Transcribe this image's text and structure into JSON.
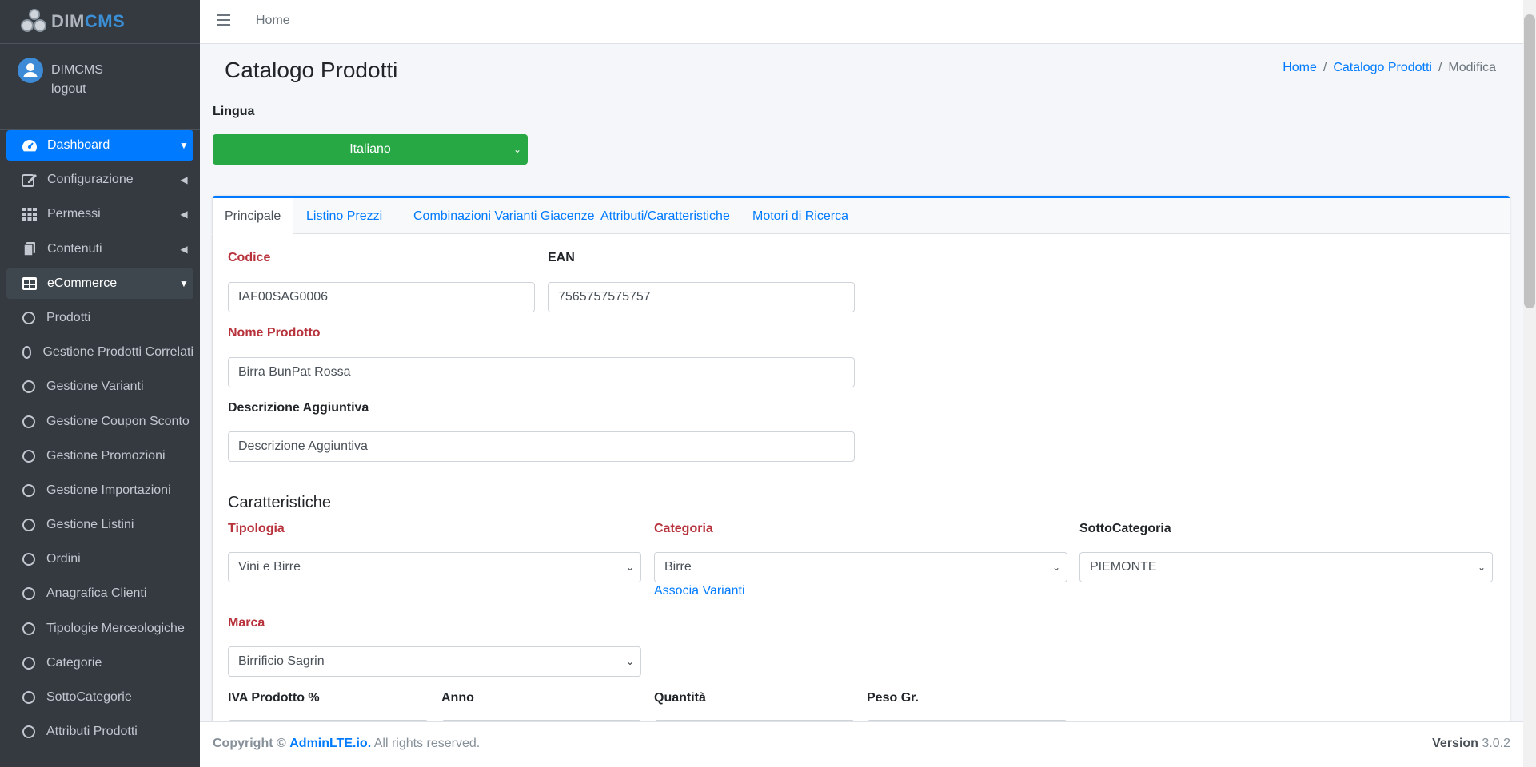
{
  "brand": {
    "part1": "DIM",
    "part2": "CMS"
  },
  "user": {
    "name": "DIMCMS",
    "logout": "logout"
  },
  "sidebar": {
    "items": [
      {
        "label": "Dashboard",
        "icon": "gauge-icon",
        "arrow": "down"
      },
      {
        "label": "Configurazione",
        "icon": "edit-icon",
        "arrow": "left"
      },
      {
        "label": "Permessi",
        "icon": "grid-icon",
        "arrow": "left"
      },
      {
        "label": "Contenuti",
        "icon": "copy-icon",
        "arrow": "left"
      },
      {
        "label": "eCommerce",
        "icon": "table-icon",
        "arrow": "down"
      }
    ],
    "subitems": [
      "Prodotti",
      "Gestione Prodotti Correlati",
      "Gestione Varianti",
      "Gestione Coupon Sconto",
      "Gestione Promozioni",
      "Gestione Importazioni",
      "Gestione Listini",
      "Ordini",
      "Anagrafica Clienti",
      "Tipologie Merceologiche",
      "Categorie",
      "SottoCategorie",
      "Attributi Prodotti"
    ]
  },
  "topbar": {
    "home": "Home"
  },
  "header": {
    "title": "Catalogo Prodotti",
    "breadcrumb": [
      "Home",
      "Catalogo Prodotti",
      "Modifica"
    ],
    "separator": "/"
  },
  "lingua": {
    "label": "Lingua",
    "value": "Italiano"
  },
  "tabs": [
    "Principale",
    "Listino Prezzi",
    "Combinazioni Varianti Giacenze",
    "Attributi/Caratteristiche",
    "Motori di Ricerca"
  ],
  "form": {
    "codice": {
      "label": "Codice",
      "value": "IAF00SAG0006"
    },
    "ean": {
      "label": "EAN",
      "value": "7565757575757"
    },
    "nome": {
      "label": "Nome Prodotto",
      "value": "Birra BunPat Rossa"
    },
    "descrizione": {
      "label": "Descrizione Aggiuntiva",
      "value": "Descrizione Aggiuntiva"
    },
    "section": "Caratteristiche",
    "tipologia": {
      "label": "Tipologia",
      "value": "Vini e Birre"
    },
    "categoria": {
      "label": "Categoria",
      "value": "Birre"
    },
    "sottocategoria": {
      "label": "SottoCategoria",
      "value": "PIEMONTE"
    },
    "associa": "Associa Varianti",
    "marca": {
      "label": "Marca",
      "value": "Birrificio Sagrin"
    },
    "iva": {
      "label": "IVA Prodotto %"
    },
    "anno": {
      "label": "Anno"
    },
    "quantita": {
      "label": "Quantità"
    },
    "peso": {
      "label": "Peso Gr."
    }
  },
  "footer": {
    "copyright": "Copyright ©",
    "link": "AdminLTE.io.",
    "rights": "All rights reserved.",
    "version_label": "Version",
    "version": "3.0.2"
  },
  "colors": {
    "sidebar": "#343a40",
    "accent": "#007bff",
    "success": "#28a745",
    "required": "#b8323c"
  }
}
